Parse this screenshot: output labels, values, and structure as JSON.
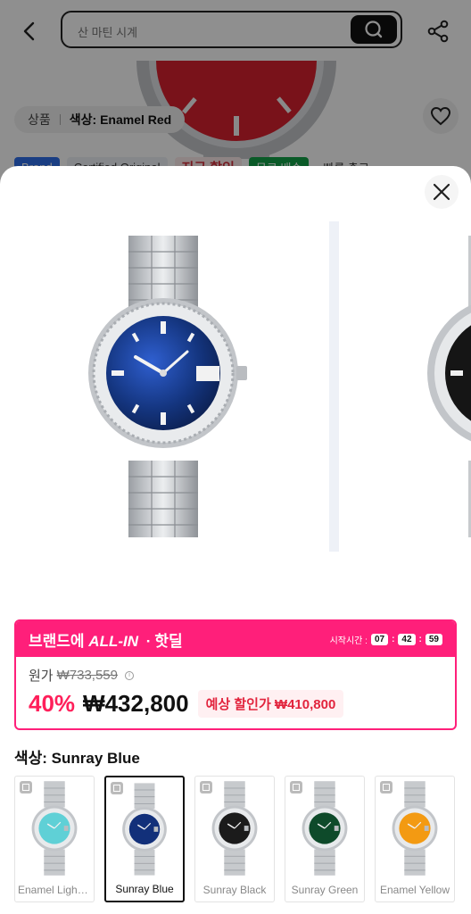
{
  "background_page": {
    "search_placeholder": "산 마틴 시계",
    "option_label": "상품",
    "option_value": "색상: Enamel Red",
    "badges": [
      "Brand",
      "Certified Original",
      "지금 할인",
      "무료 배송",
      "빠른 출고"
    ]
  },
  "deal": {
    "title_prefix": "브랜드에",
    "title_allin": "ALL-IN",
    "title_dot": "·",
    "title_suffix": "핫딜",
    "timer_label": "시작시간 :",
    "timer_hours": "07",
    "timer_minutes": "42",
    "timer_seconds": "59",
    "original_label": "원가",
    "original_price": "₩733,559",
    "discount": "40%",
    "price": "₩432,800",
    "estimated_discount": "예상 할인가 ₩410,800"
  },
  "color_section": {
    "title": "색상: Sunray Blue",
    "options": [
      {
        "name": "Enamel Light ...",
        "dial_color": "#5fd0d6",
        "selected": false
      },
      {
        "name": "Sunray Blue",
        "dial_color": "#12307a",
        "selected": true
      },
      {
        "name": "Sunray Black",
        "dial_color": "#1b1b1b",
        "selected": false
      },
      {
        "name": "Sunray Green",
        "dial_color": "#0e4a2a",
        "selected": false
      },
      {
        "name": "Enamel Yellow",
        "dial_color": "#f39a12",
        "selected": false
      }
    ]
  },
  "colors": {
    "accent_pink": "#ff1f7a",
    "discount_red": "#ff1f5a"
  }
}
